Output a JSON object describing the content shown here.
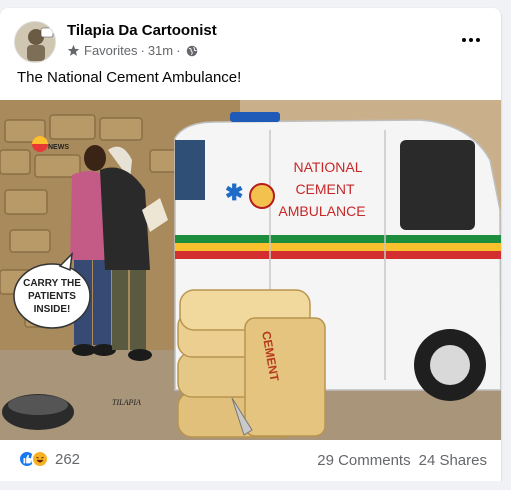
{
  "post": {
    "author": "Tilapia Da Cartoonist",
    "audience": "Favorites",
    "separator": "·",
    "time": "31m",
    "text": "The National Cement Ambulance!"
  },
  "image": {
    "ambulance_text_line1": "NATIONAL",
    "ambulance_text_line2": "CEMENT",
    "ambulance_text_line3": "AMBULANCE",
    "speech_line1": "CARRY THE",
    "speech_line2": "PATIENTS",
    "speech_line3": "INSIDE!",
    "bag_label": "CEMENT",
    "watermark_logo": "NEWS",
    "signature": "TILAPIA"
  },
  "footer": {
    "reaction_count": "262",
    "comments": "29 Comments",
    "shares": "24 Shares"
  },
  "icons": {
    "more": "more-options-icon",
    "star": "star-icon",
    "globe": "globe-icon",
    "like": "like-reaction-icon",
    "haha": "haha-reaction-icon"
  },
  "colors": {
    "like_blue": "#1877f2",
    "haha_yellow": "#f7b125",
    "secondary_text": "#65676b"
  }
}
